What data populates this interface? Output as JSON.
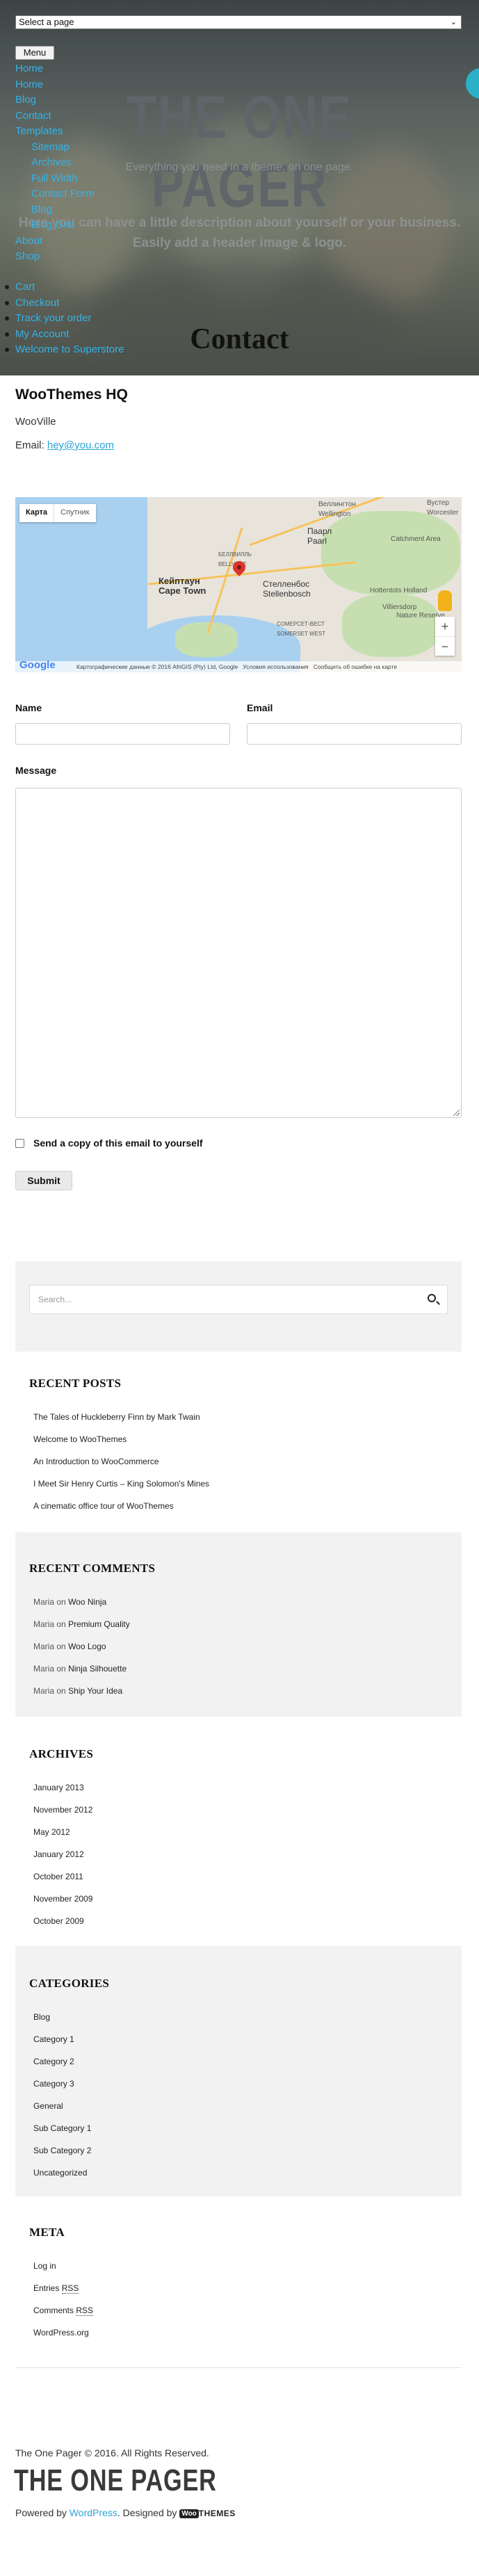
{
  "header": {
    "page_select": "Select a page",
    "menu_button": "Menu",
    "site_title": "THE ONE PAGER",
    "tagline": "Everything you need in a theme, on one page.",
    "description": "Here you can have a little description about yourself or your business. Easily add a header image & logo.",
    "nav": [
      {
        "label": "Home"
      },
      {
        "label": "Home"
      },
      {
        "label": "Blog"
      },
      {
        "label": "Contact"
      },
      {
        "label": "Templates"
      },
      {
        "label": "Sitemap"
      },
      {
        "label": "Archives"
      },
      {
        "label": "Full Width"
      },
      {
        "label": "Contact Form"
      },
      {
        "label": "Blog"
      },
      {
        "label": "Blog Grid"
      },
      {
        "label": "About"
      },
      {
        "label": "Shop"
      }
    ],
    "bullet_links": [
      {
        "label": "Cart"
      },
      {
        "label": "Checkout"
      },
      {
        "label": "Track your order"
      },
      {
        "label": "My Account"
      },
      {
        "label": "Welcome to Superstore"
      }
    ]
  },
  "page": {
    "heading": "Contact",
    "hq_title": "WooThemes HQ",
    "city": "WooVille",
    "email_label": "Email:",
    "email": "hey@you.com"
  },
  "map": {
    "type_map": "Карта",
    "type_satellite": "Спутник",
    "labels": {
      "city_main": "Кейптаун",
      "city_main_en": "Cape Town",
      "stellenbosch": "Стелленбос",
      "stellenbosch_en": "Stellenbosch",
      "paarl": "Паарл",
      "paarl_en": "Paarl",
      "wellington": "Веллингтон",
      "wellington_en": "Wellington",
      "worcester": "Вустер",
      "worcester_en": "Worcester",
      "bellville": "БЕЛЛВИЛЛЬ",
      "bellville_en": "BELLVILLE",
      "somerset": "СОМЕРСЕТ-ВЕСТ",
      "somerset_en": "SOMERSET WEST",
      "villiersdorp": "Villiersdorp",
      "catchment": "Catchment Area",
      "nature": "Nature Reserve",
      "hottentots": "Hottentots Holland"
    },
    "zoom_in": "+",
    "zoom_out": "−",
    "google": "Google",
    "attribution": "Картографические данные © 2016 AfriGIS (Pty) Ltd, Google",
    "terms": "Условия использования",
    "report": "Сообщить об ошибке на карте"
  },
  "form": {
    "name_label": "Name",
    "email_label": "Email",
    "message_label": "Message",
    "copy_label": "Send a copy of this email to yourself",
    "submit_label": "Submit"
  },
  "sidebar": {
    "search_placeholder": "Search...",
    "recent_posts": {
      "title": "RECENT POSTS",
      "items": [
        "The Tales of Huckleberry Finn by Mark Twain",
        "Welcome to WooThemes",
        "An Introduction to WooCommerce",
        "I Meet Sir Henry Curtis – King Solomon's Mines",
        "A cinematic office tour of WooThemes"
      ]
    },
    "recent_comments": {
      "title": "RECENT COMMENTS",
      "connector": "on",
      "items": [
        {
          "author": "Maria",
          "post": "Woo Ninja"
        },
        {
          "author": "Maria",
          "post": "Premium Quality"
        },
        {
          "author": "Maria",
          "post": "Woo Logo"
        },
        {
          "author": "Maria",
          "post": "Ninja Silhouette"
        },
        {
          "author": "Maria",
          "post": "Ship Your Idea"
        }
      ]
    },
    "archives": {
      "title": "ARCHIVES",
      "items": [
        "January 2013",
        "November 2012",
        "May 2012",
        "January 2012",
        "October 2011",
        "November 2009",
        "October 2009"
      ]
    },
    "categories": {
      "title": "CATEGORIES",
      "items": [
        "Blog",
        "Category 1",
        "Category 2",
        "Category 3",
        "General",
        "Sub Category 1",
        "Sub Category 2",
        "Uncategorized"
      ]
    },
    "meta": {
      "title": "META",
      "items": [
        {
          "text": "Log in",
          "rss": ""
        },
        {
          "text": "Entries ",
          "rss": "RSS"
        },
        {
          "text": "Comments ",
          "rss": "RSS"
        },
        {
          "text": "WordPress.org",
          "rss": ""
        }
      ]
    }
  },
  "footer": {
    "copyright": "The One Pager © 2016. All Rights Reserved.",
    "logo": "THE ONE PAGER",
    "powered_by": "Powered by",
    "wordpress": "WordPress",
    "designed_by": ". Designed by",
    "woo_mark": "Woo",
    "woo_text": "THEMES"
  },
  "colors": {
    "link": "#33b3ea",
    "accent": "#2aa4d8",
    "widget_bg": "#f2f2f2"
  }
}
